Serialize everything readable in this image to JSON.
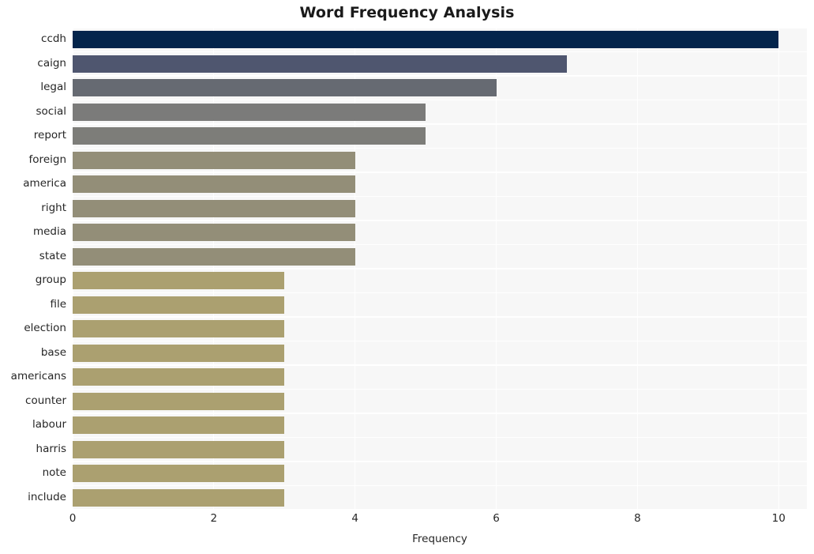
{
  "chart_data": {
    "type": "bar",
    "orientation": "horizontal",
    "title": "Word Frequency Analysis",
    "xlabel": "Frequency",
    "ylabel": "",
    "xlim": [
      0,
      10.4
    ],
    "xticks": [
      0,
      2,
      4,
      6,
      8,
      10
    ],
    "xtick_labels": [
      "0",
      "2",
      "4",
      "6",
      "8",
      "10"
    ],
    "grid": true,
    "legend": null,
    "categories": [
      "ccdh",
      "caign",
      "legal",
      "social",
      "report",
      "foreign",
      "america",
      "right",
      "media",
      "state",
      "group",
      "file",
      "election",
      "base",
      "americans",
      "counter",
      "labour",
      "harris",
      "note",
      "include"
    ],
    "values": [
      10,
      7,
      6,
      5,
      5,
      4,
      4,
      4,
      4,
      4,
      3,
      3,
      3,
      3,
      3,
      3,
      3,
      3,
      3,
      3
    ],
    "bar_colors": [
      "#04254c",
      "#4f566f",
      "#666a72",
      "#7b7b7a",
      "#7d7d79",
      "#938e78",
      "#938e78",
      "#938e78",
      "#938e78",
      "#938e78",
      "#aba070",
      "#aba070",
      "#aba070",
      "#aba070",
      "#aba070",
      "#aba070",
      "#aba070",
      "#aba070",
      "#aba070",
      "#aba070"
    ],
    "plot_background": "#f7f7f7",
    "grid_color": "#ffffff",
    "figure_background": "#ffffff"
  }
}
